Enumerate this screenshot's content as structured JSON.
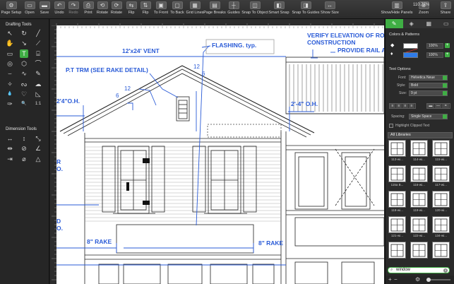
{
  "toolbar": {
    "items": [
      {
        "label": "Page Setup",
        "icon": "gear-icon",
        "glyph": "⚙"
      },
      {
        "label": "Open",
        "icon": "open-icon",
        "glyph": "▭"
      },
      {
        "label": "Save",
        "icon": "save-icon",
        "glyph": "▬"
      },
      {
        "label": "Undo",
        "icon": "undo-icon",
        "glyph": "↶"
      },
      {
        "label": "Redo",
        "icon": "redo-icon",
        "glyph": "↷"
      },
      {
        "label": "Print",
        "icon": "print-icon",
        "glyph": "⎙"
      },
      {
        "label": "Rotate",
        "icon": "rotate-left-icon",
        "glyph": "⟲"
      },
      {
        "label": "Rotate",
        "icon": "rotate-right-icon",
        "glyph": "⟳"
      },
      {
        "label": "Flip",
        "icon": "flip-horizontal-icon",
        "glyph": "⇆"
      },
      {
        "label": "Flip",
        "icon": "flip-vertical-icon",
        "glyph": "⇅"
      },
      {
        "label": "To Front",
        "icon": "to-front-icon",
        "glyph": "▣"
      },
      {
        "label": "To Back",
        "icon": "to-back-icon",
        "glyph": "▢"
      },
      {
        "label": "Grid Lines",
        "icon": "grid-lines-icon",
        "glyph": "▦"
      },
      {
        "label": "Page Breaks",
        "icon": "page-breaks-icon",
        "glyph": "▤"
      },
      {
        "label": "Guides",
        "icon": "guides-icon",
        "glyph": "┼"
      },
      {
        "label": "Snap To Object",
        "icon": "snap-object-icon",
        "glyph": "◫"
      },
      {
        "label": "Smart Snap",
        "icon": "smart-snap-icon",
        "glyph": "◧"
      },
      {
        "label": "Snap To Guides",
        "icon": "snap-guides-icon",
        "glyph": "◨"
      },
      {
        "label": "Show Size",
        "icon": "show-size-icon",
        "glyph": "↔"
      },
      {
        "label": "Show/Hide Panels",
        "icon": "panels-icon",
        "glyph": "▥"
      },
      {
        "label": "Zoom",
        "icon": "zoom-icon",
        "glyph": "⊕"
      },
      {
        "label": "Share",
        "icon": "share-icon",
        "glyph": "⇪"
      }
    ],
    "zoom_value": "110.77%"
  },
  "left_panel": {
    "drafting_title": "Drafting Tools",
    "dimension_title": "Dimension Tools",
    "drafting_tools": [
      {
        "name": "arrow-tool-icon",
        "glyph": "↖"
      },
      {
        "name": "rotate-tool-icon",
        "glyph": "↻"
      },
      {
        "name": "line-tool-icon",
        "glyph": "╱"
      },
      {
        "name": "hand-tool-icon",
        "glyph": "✋"
      },
      {
        "name": "arrow-line-tool-icon",
        "glyph": "↘"
      },
      {
        "name": "wall-tool-icon",
        "glyph": "⟋"
      },
      {
        "name": "rectangle-tool-icon",
        "glyph": "▭"
      },
      {
        "name": "text-tool-icon",
        "glyph": "T"
      },
      {
        "name": "callout-tool-icon",
        "glyph": "⌸"
      },
      {
        "name": "circle-tool-icon",
        "glyph": "◎"
      },
      {
        "name": "polygon-tool-icon",
        "glyph": "⬡"
      },
      {
        "name": "arc-tool-icon",
        "glyph": "⌒"
      },
      {
        "name": "curve-tool-icon",
        "glyph": "⌣"
      },
      {
        "name": "spline-tool-icon",
        "glyph": "∿"
      },
      {
        "name": "pen-tool-icon",
        "glyph": "✎"
      },
      {
        "name": "star-tool-icon",
        "glyph": "✧"
      },
      {
        "name": "bezier-tool-icon",
        "glyph": "ᔓ"
      },
      {
        "name": "cloud-tool-icon",
        "glyph": "☁"
      },
      {
        "name": "droplet-tool-icon",
        "glyph": "💧"
      },
      {
        "name": "heart-shape-tool-icon",
        "glyph": "♡"
      },
      {
        "name": "slice-tool-icon",
        "glyph": "◺"
      },
      {
        "name": "eyedropper-tool-icon",
        "glyph": "✑"
      },
      {
        "name": "magnify-tool-icon",
        "glyph": "🔍"
      },
      {
        "name": "scale-tool-icon",
        "glyph": "1:1"
      }
    ],
    "dimension_tools": [
      {
        "name": "horizontal-dimension-icon",
        "glyph": "↔"
      },
      {
        "name": "vertical-dimension-icon",
        "glyph": "↕"
      },
      {
        "name": "aligned-dimension-icon",
        "glyph": "⤡"
      },
      {
        "name": "chain-dimension-icon",
        "glyph": "⇹"
      },
      {
        "name": "radius-dimension-icon",
        "glyph": "⊘"
      },
      {
        "name": "angle-dimension-icon",
        "glyph": "∠"
      },
      {
        "name": "baseline-dimension-icon",
        "glyph": "⇥"
      },
      {
        "name": "diameter-dimension-icon",
        "glyph": "⌀"
      },
      {
        "name": "area-dimension-icon",
        "glyph": "△"
      }
    ]
  },
  "drawing": {
    "notes": {
      "verify": "VERIFY ELEVATION OF ROOF",
      "construction": "CONSTRUCTION",
      "provide_rail": "PROVIDE RAIL AT",
      "flashing": "FLASHING. typ.",
      "vent": "12'x24' VENT",
      "trim": "P.T TRM (SEE RAKE DETAIL)",
      "pitch_12a": "12",
      "pitch_6a": "6",
      "pitch_12b": "12",
      "pitch_6b": "6",
      "oh_left": "2'4\"O.H.",
      "oh_right": "2'-4\" O.H.",
      "rake_left": "8\" RAKE",
      "rake_right": "8\" RAKE",
      "frag_r": "R",
      "frag_o": "O.",
      "frag_d": "D",
      "frag_o2": "O."
    }
  },
  "right_panel": {
    "colors_title": "Colors & Patterns",
    "stroke_color": "#ffffff",
    "fill_color": "#2f7be8",
    "stroke_pct": "100%",
    "fill_pct": "100%",
    "text_title": "Text Options",
    "font_label": "Font:",
    "font_value": "Helvetica Neue",
    "style_label": "Style:",
    "style_value": "Bold",
    "size_label": "Size:",
    "size_value": "9 pt",
    "spacing_label": "Spacing:",
    "spacing_value": "Single Space",
    "highlight_label": "Highlight Clipped Text",
    "library_value": "All Libraries",
    "library_items": [
      "113-wi...",
      "114-wi...",
      "115-wi...",
      "115a B...",
      "116-wi...",
      "117-wi...",
      "118-wi...",
      "119-wi...",
      "120-wi...",
      "121-wi...",
      "122-wi...",
      "134-wi...",
      "",
      "",
      ""
    ],
    "search_value": "window",
    "accent": "#3fae44"
  }
}
